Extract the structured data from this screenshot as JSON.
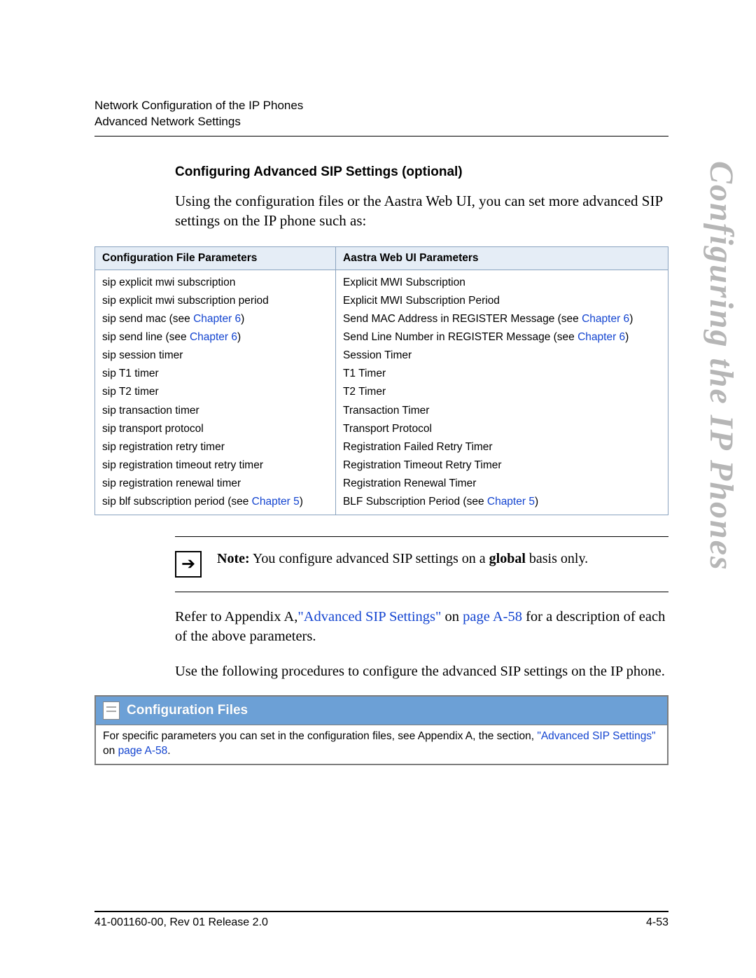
{
  "header": {
    "line1": "Network Configuration of the IP Phones",
    "line2": "Advanced Network Settings"
  },
  "sideTitle": "Configuring the IP Phones",
  "section": {
    "title": "Configuring Advanced SIP Settings (optional)",
    "intro": "Using the configuration files or the Aastra Web UI, you can set more advanced SIP settings on the IP phone such as:"
  },
  "table": {
    "col1": "Configuration File Parameters",
    "col2": "Aastra Web UI Parameters",
    "rows": [
      {
        "c1a": "sip explicit mwi subscription",
        "c2a": "Explicit MWI Subscription"
      },
      {
        "c1a": "sip explicit mwi subscription period",
        "c2a": "Explicit MWI Subscription Period"
      },
      {
        "c1a": "sip send mac (see ",
        "c1l": "Chapter 6",
        "c1b": ")",
        "c2a": "Send MAC Address in REGISTER Message (see ",
        "c2l": "Chapter 6",
        "c2b": ")"
      },
      {
        "c1a": "sip send line (see ",
        "c1l": "Chapter 6",
        "c1b": ")",
        "c2a": "Send Line Number in REGISTER Message (see ",
        "c2l": "Chapter 6",
        "c2b": ")"
      },
      {
        "c1a": "sip session timer",
        "c2a": "Session Timer"
      },
      {
        "c1a": "sip T1 timer",
        "c2a": "T1 Timer"
      },
      {
        "c1a": "sip T2 timer",
        "c2a": "T2 Timer"
      },
      {
        "c1a": "sip transaction timer",
        "c2a": "Transaction Timer"
      },
      {
        "c1a": "sip transport protocol",
        "c2a": "Transport Protocol"
      },
      {
        "c1a": "sip registration retry timer",
        "c2a": "Registration Failed Retry Timer"
      },
      {
        "c1a": "sip registration timeout retry timer",
        "c2a": "Registration Timeout Retry Timer"
      },
      {
        "c1a": "sip registration renewal timer",
        "c2a": "Registration Renewal Timer"
      },
      {
        "c1a": "sip blf subscription period (see ",
        "c1l": "Chapter 5",
        "c1b": ")",
        "c2a": "BLF Subscription Period (see ",
        "c2l": "Chapter 5",
        "c2b": ")"
      }
    ]
  },
  "note": {
    "label": "Note:",
    "before": " You configure advanced SIP settings on a ",
    "bold": "global",
    "after": " basis only."
  },
  "refer": {
    "pre": "Refer to Appendix A,",
    "link1": "\"Advanced SIP Settings\"",
    "mid": " on ",
    "link2": "page A-58",
    "post": " for a description of each of the above parameters."
  },
  "proc": "Use the following procedures to configure the advanced SIP settings on the IP phone.",
  "configBox": {
    "title": "Configuration Files",
    "body1": "For specific parameters you can set in the configuration files, see Appendix A, the section, ",
    "link1": "\"Advanced SIP Settings\"",
    "mid": " on ",
    "link2": "page A-58",
    "post": "."
  },
  "footer": {
    "left": "41-001160-00, Rev 01  Release 2.0",
    "right": "4-53"
  }
}
